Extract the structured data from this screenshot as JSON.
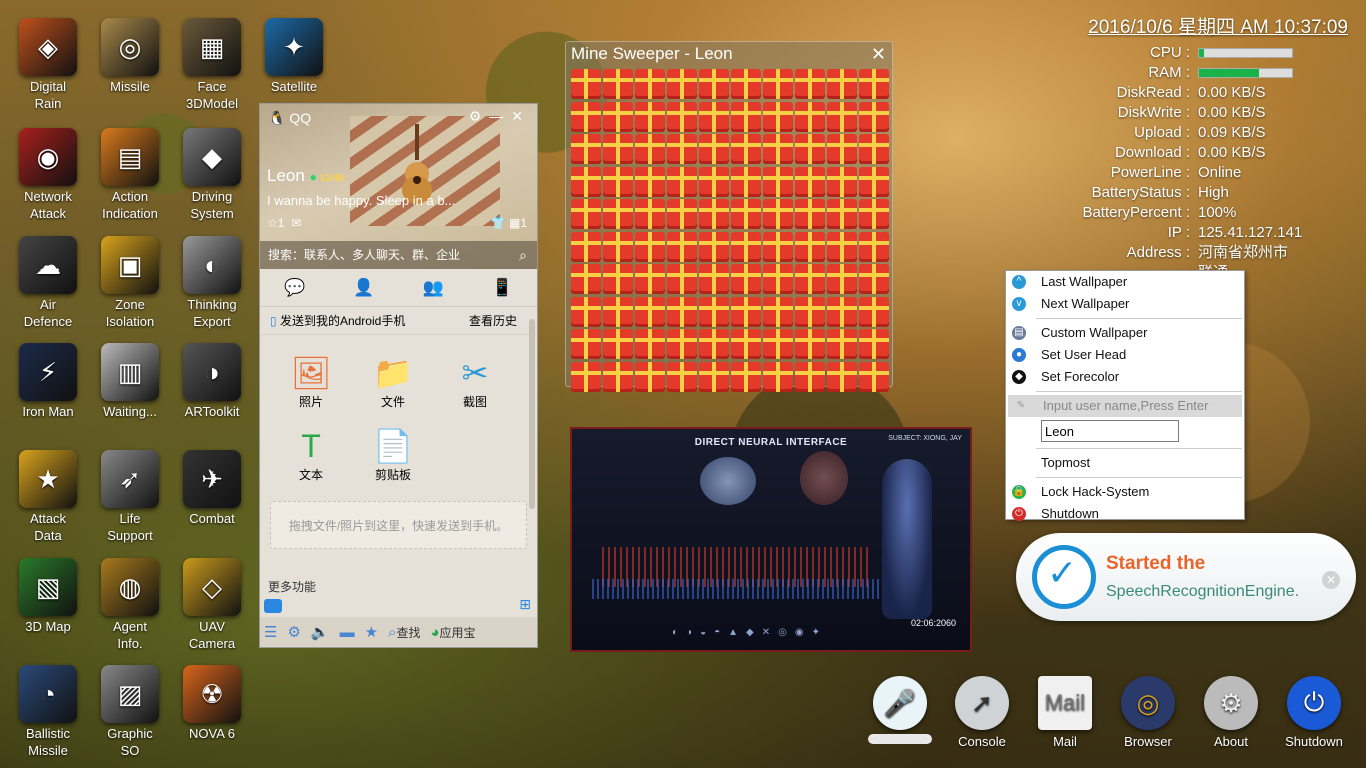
{
  "desktop_icons": [
    {
      "label1": "Digital",
      "label2": "Rain",
      "glyph": "◈",
      "color": "#c0501c"
    },
    {
      "label1": "Missile",
      "label2": "",
      "glyph": "◎",
      "color": "#a8894a"
    },
    {
      "label1": "Face",
      "label2": "3DModel",
      "glyph": "▦",
      "color": "#6b5a3a"
    },
    {
      "label1": "Satellite",
      "label2": "",
      "glyph": "✦",
      "color": "#1c6aa8"
    },
    {
      "label1": "Network",
      "label2": "Attack",
      "glyph": "◉",
      "color": "#a8201c"
    },
    {
      "label1": "Action",
      "label2": "Indication",
      "glyph": "▤",
      "color": "#d97a1c"
    },
    {
      "label1": "Driving",
      "label2": "System",
      "glyph": "◆",
      "color": "#777"
    },
    {
      "label1": "Air",
      "label2": "Defence",
      "glyph": "☁",
      "color": "#444"
    },
    {
      "label1": "Zone",
      "label2": "Isolation",
      "glyph": "▣",
      "color": "#d9a31c"
    },
    {
      "label1": "Thinking",
      "label2": "Export",
      "glyph": "◐",
      "color": "#999"
    },
    {
      "label1": "Iron Man",
      "label2": "",
      "glyph": "⚡",
      "color": "#1c2a4a"
    },
    {
      "label1": "Waiting...",
      "label2": "",
      "glyph": "▥",
      "color": "#bbb"
    },
    {
      "label1": "ARToolkit",
      "label2": "",
      "glyph": "◑",
      "color": "#555"
    },
    {
      "label1": "Attack",
      "label2": "Data",
      "glyph": "★",
      "color": "#d9a31c"
    },
    {
      "label1": "Life",
      "label2": "Support",
      "glyph": "➶",
      "color": "#888"
    },
    {
      "label1": "Combat",
      "label2": "",
      "glyph": "✈",
      "color": "#333"
    },
    {
      "label1": "3D Map",
      "label2": "",
      "glyph": "▧",
      "color": "#2a7a2a"
    },
    {
      "label1": "Agent",
      "label2": "Info.",
      "glyph": "◍",
      "color": "#a87a1c"
    },
    {
      "label1": "UAV",
      "label2": "Camera",
      "glyph": "◇",
      "color": "#c99a1c"
    },
    {
      "label1": "Ballistic",
      "label2": "Missile",
      "glyph": "◔",
      "color": "#2a4a7a"
    },
    {
      "label1": "Graphic",
      "label2": "SO",
      "glyph": "▨",
      "color": "#888"
    },
    {
      "label1": "NOVA 6",
      "label2": "",
      "glyph": "☢",
      "color": "#d9651c"
    }
  ],
  "sysinfo": {
    "clock": "2016/10/6 星期四 AM 10:37:09",
    "rows": [
      {
        "k": "CPU :",
        "v": ""
      },
      {
        "k": "RAM :",
        "v": ""
      },
      {
        "k": "DiskRead :",
        "v": "0.00 KB/S"
      },
      {
        "k": "DiskWrite :",
        "v": "0.00 KB/S"
      },
      {
        "k": "Upload :",
        "v": "0.09 KB/S"
      },
      {
        "k": "Download :",
        "v": "0.00 KB/S"
      },
      {
        "k": "PowerLine :",
        "v": "Online"
      },
      {
        "k": "BatteryStatus :",
        "v": "High"
      },
      {
        "k": "BatteryPercent :",
        "v": "100%"
      },
      {
        "k": "IP :",
        "v": "125.41.127.141"
      },
      {
        "k": "Address :",
        "v": "河南省郑州市"
      },
      {
        "k": "",
        "v": "联通"
      }
    ],
    "cpu_usage": 0.05,
    "ram_usage": 0.65,
    "bar_color": "#19b34a"
  },
  "minesweeper": {
    "title": "Mine Sweeper - Leon",
    "close": "✕",
    "cell_count": 100
  },
  "qq": {
    "app": "QQ",
    "nickname": "Leon",
    "level": "LV45",
    "signature": "I wanna be happy. Sleep in a b...",
    "star_count": "1",
    "right_count": "1",
    "search_placeholder": "搜索：联系人、多人聊天、群、企业",
    "send_to": "发送到我的Android手机",
    "history": "查看历史",
    "tools": [
      {
        "label": "照片",
        "glyph": "🖼",
        "color": "#e8733a"
      },
      {
        "label": "文件",
        "glyph": "📁",
        "color": "#f0b020"
      },
      {
        "label": "截图",
        "glyph": "✂",
        "color": "#2a9ad6"
      },
      {
        "label": "文本",
        "glyph": "T",
        "color": "#2aa84a"
      },
      {
        "label": "剪贴板",
        "glyph": "📄",
        "color": "#3a7ad6"
      }
    ],
    "drop_hint": "拖拽文件/照片到这里，快速发送到手机。",
    "more": "更多功能",
    "find": "查找",
    "appstore": "应用宝"
  },
  "neural": {
    "title": "DIRECT NEURAL INTERFACE",
    "subject": "SUBJECT: XIONG, JAY",
    "time": "02:06:2060"
  },
  "menu": {
    "items1": [
      {
        "label": "Last Wallpaper",
        "icon": "^",
        "color": "#2a9ad6"
      },
      {
        "label": "Next Wallpaper",
        "icon": "v",
        "color": "#2a9ad6"
      }
    ],
    "items2": [
      {
        "label": "Custom Wallpaper",
        "icon": "▤",
        "color": "#6a7a9a"
      },
      {
        "label": "Set User Head",
        "icon": "●",
        "color": "#2a7ad6"
      },
      {
        "label": "Set Forecolor",
        "icon": "◆",
        "color": "#111"
      }
    ],
    "input_hint": "Input user name,Press Enter",
    "input_value": "Leon",
    "topmost": "Topmost",
    "lock": "Lock Hack-System",
    "shutdown": "Shutdown"
  },
  "toast": {
    "line1": "Started the",
    "line2": "SpeechRecognitionEngine."
  },
  "dock": [
    {
      "label": "",
      "glyph": "🎤",
      "bg": "#e8f4f8",
      "fg": "#1b8fd6"
    },
    {
      "label": "Console",
      "glyph": "➚",
      "bg": "#cfd3d6",
      "fg": "#333"
    },
    {
      "label": "Mail",
      "glyph": "Mail",
      "bg": "#f0f0f0",
      "fg": "#777"
    },
    {
      "label": "Browser",
      "glyph": "◎",
      "bg": "#2a3a6a",
      "fg": "#d9a31c"
    },
    {
      "label": "About",
      "glyph": "⚙",
      "bg": "#bbb",
      "fg": "#eee"
    },
    {
      "label": "Shutdown",
      "glyph": "⏻",
      "bg": "#1b5ad6",
      "fg": "#fff"
    }
  ]
}
